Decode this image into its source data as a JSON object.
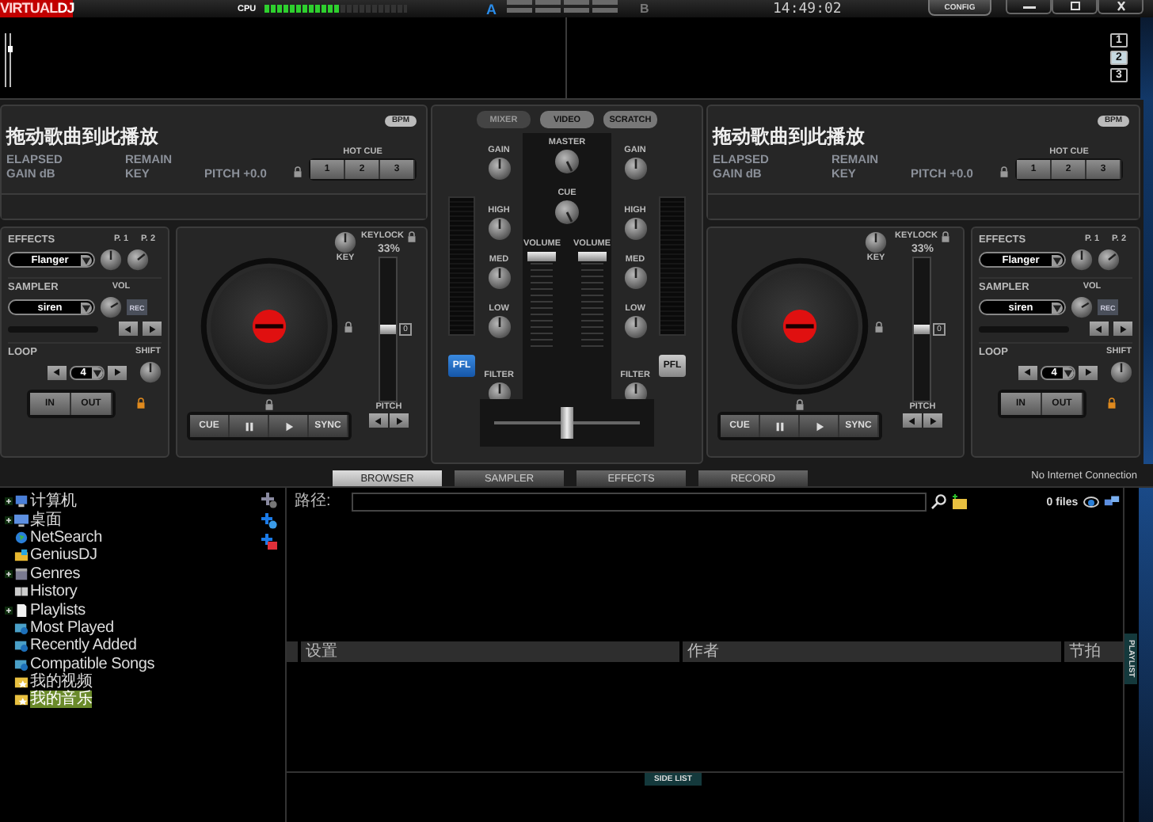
{
  "top_bar": {
    "logo": {
      "part1": "VIRTUAL",
      "part2": "DJ"
    },
    "cpu": {
      "label": "CPU",
      "level": 0.52
    },
    "crossfader_indicator": {
      "a": "A",
      "b": "B"
    },
    "clock": "14:49:02",
    "config": "CONFIG"
  },
  "waveform": {
    "zoom_buttons": [
      {
        "label": "1",
        "selected": false
      },
      {
        "label": "2",
        "selected": true
      },
      {
        "label": "3",
        "selected": false
      }
    ]
  },
  "decks": [
    {
      "title": "拖动歌曲到此播放",
      "bpm": "BPM",
      "elapsed": "ELAPSED",
      "gain": "GAIN dB",
      "remain": "REMAIN",
      "key": "KEY",
      "pitch": "PITCH +0.0",
      "hot_cue": {
        "label": "HOT CUE",
        "buttons": [
          "1",
          "2",
          "3"
        ]
      },
      "effects": {
        "label": "EFFECTS",
        "value": "Flanger",
        "p1": "P. 1",
        "p2": "P. 2"
      },
      "sampler": {
        "label": "SAMPLER",
        "value": "siren",
        "vol": "VOL",
        "rec": "REC"
      },
      "loop": {
        "label": "LOOP",
        "value": "4",
        "shift": "SHIFT",
        "in": "IN",
        "out": "OUT"
      },
      "keylock": "KEYLOCK",
      "key_knob": "KEY",
      "pitch_range": "33%",
      "zero": "0",
      "pitch_fader": {
        "level": 0.5
      },
      "pitch_label": "PITCH",
      "transport": [
        {
          "kind": "text",
          "label": "CUE"
        },
        {
          "kind": "pause"
        },
        {
          "kind": "play"
        },
        {
          "kind": "text",
          "label": "SYNC"
        }
      ]
    },
    {
      "title": "拖动歌曲到此播放",
      "bpm": "BPM",
      "elapsed": "ELAPSED",
      "gain": "GAIN dB",
      "remain": "REMAIN",
      "key": "KEY",
      "pitch": "PITCH +0.0",
      "hot_cue": {
        "label": "HOT CUE",
        "buttons": [
          "1",
          "2",
          "3"
        ]
      },
      "effects": {
        "label": "EFFECTS",
        "value": "Flanger",
        "p1": "P. 1",
        "p2": "P. 2"
      },
      "sampler": {
        "label": "SAMPLER",
        "value": "siren",
        "vol": "VOL",
        "rec": "REC"
      },
      "loop": {
        "label": "LOOP",
        "value": "4",
        "shift": "SHIFT",
        "in": "IN",
        "out": "OUT"
      },
      "keylock": "KEYLOCK",
      "key_knob": "KEY",
      "pitch_range": "33%",
      "zero": "0",
      "pitch_fader": {
        "level": 0.5
      },
      "pitch_label": "PITCH",
      "transport": [
        {
          "kind": "text",
          "label": "CUE"
        },
        {
          "kind": "pause"
        },
        {
          "kind": "play"
        },
        {
          "kind": "text",
          "label": "SYNC"
        }
      ]
    }
  ],
  "mixer": {
    "tabs": [
      {
        "label": "MIXER",
        "selected": true
      },
      {
        "label": "VIDEO",
        "selected": false
      },
      {
        "label": "SCRATCH",
        "selected": false
      }
    ],
    "channels": [
      {
        "gain": "GAIN",
        "high": "HIGH",
        "med": "MED",
        "low": "LOW",
        "filter": "FILTER",
        "pfl": {
          "label": "PFL",
          "on": true
        }
      },
      {
        "gain": "GAIN",
        "high": "HIGH",
        "med": "MED",
        "low": "LOW",
        "filter": "FILTER",
        "pfl": {
          "label": "PFL",
          "on": false
        }
      }
    ],
    "master": "MASTER",
    "cue": "CUE",
    "volumes": [
      {
        "label": "VOLUME",
        "level": 1
      },
      {
        "label": "VOLUME",
        "level": 1
      }
    ],
    "crossfader": {
      "level": 0.5
    }
  },
  "browser": {
    "tabs": [
      {
        "label": "BROWSER",
        "selected": true
      },
      {
        "label": "SAMPLER",
        "selected": false
      },
      {
        "label": "EFFECTS",
        "selected": false
      },
      {
        "label": "RECORD",
        "selected": false
      }
    ],
    "status": "No Internet Connection",
    "tree": [
      {
        "label": "计算机",
        "kind": "computer",
        "expandable": true,
        "selected": false
      },
      {
        "label": "桌面",
        "kind": "desktop",
        "expandable": true,
        "selected": false
      },
      {
        "label": "NetSearch",
        "kind": "globe",
        "expandable": false,
        "selected": false
      },
      {
        "label": "GeniusDJ",
        "kind": "genius",
        "expandable": false,
        "selected": false
      },
      {
        "label": "Genres",
        "kind": "genres",
        "expandable": true,
        "selected": false
      },
      {
        "label": "History",
        "kind": "history",
        "expandable": false,
        "selected": false
      },
      {
        "label": "Playlists",
        "kind": "playlists",
        "expandable": true,
        "selected": false
      },
      {
        "label": "Most Played",
        "kind": "smart",
        "expandable": false,
        "selected": false
      },
      {
        "label": "Recently Added",
        "kind": "smart",
        "expandable": false,
        "selected": false
      },
      {
        "label": "Compatible Songs",
        "kind": "smart",
        "expandable": false,
        "selected": false
      },
      {
        "label": "我的视频",
        "kind": "folder",
        "expandable": false,
        "selected": false
      },
      {
        "label": "我的音乐",
        "kind": "folder",
        "expandable": false,
        "selected": true
      }
    ],
    "path_label": "路径:",
    "file_count": "0 files",
    "columns": [
      "设置",
      "作者",
      "节拍"
    ],
    "playlist_tab": "PLAYLIST",
    "side_list_tab": "SIDE LIST"
  }
}
